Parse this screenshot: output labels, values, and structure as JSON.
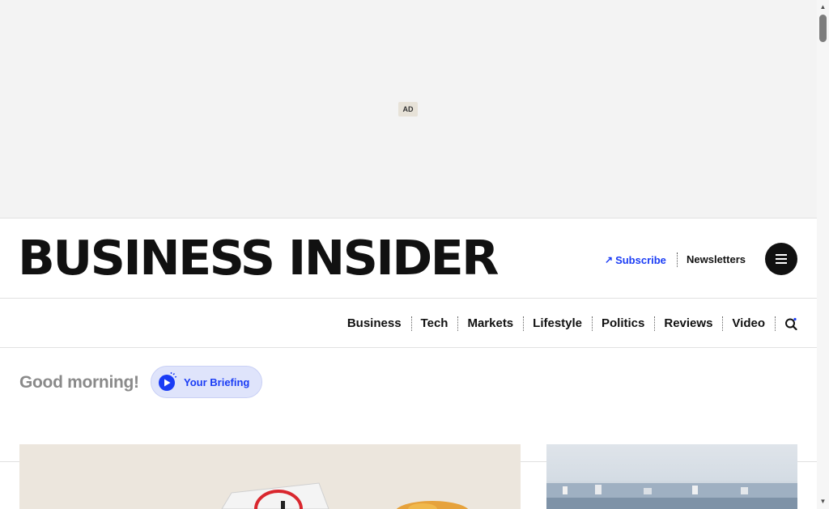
{
  "ad": {
    "label": "AD"
  },
  "header": {
    "logo_text": "BUSINESS INSIDER",
    "subscribe_label": "Subscribe",
    "newsletters_label": "Newsletters",
    "menu_icon": "hamburger-menu-icon"
  },
  "nav": {
    "items": [
      {
        "label": "Business"
      },
      {
        "label": "Tech"
      },
      {
        "label": "Markets"
      },
      {
        "label": "Lifestyle"
      },
      {
        "label": "Politics"
      },
      {
        "label": "Reviews"
      },
      {
        "label": "Video"
      }
    ],
    "search_icon": "search-icon"
  },
  "greeting": {
    "text": "Good morning!",
    "briefing_label": "Your Briefing",
    "briefing_icon": "play-icon"
  },
  "colors": {
    "accent": "#1a3cf5",
    "briefing_bg": "#dfe4fb",
    "ad_bg": "#f3f3f3",
    "greeting_text": "#8a8a8a"
  }
}
